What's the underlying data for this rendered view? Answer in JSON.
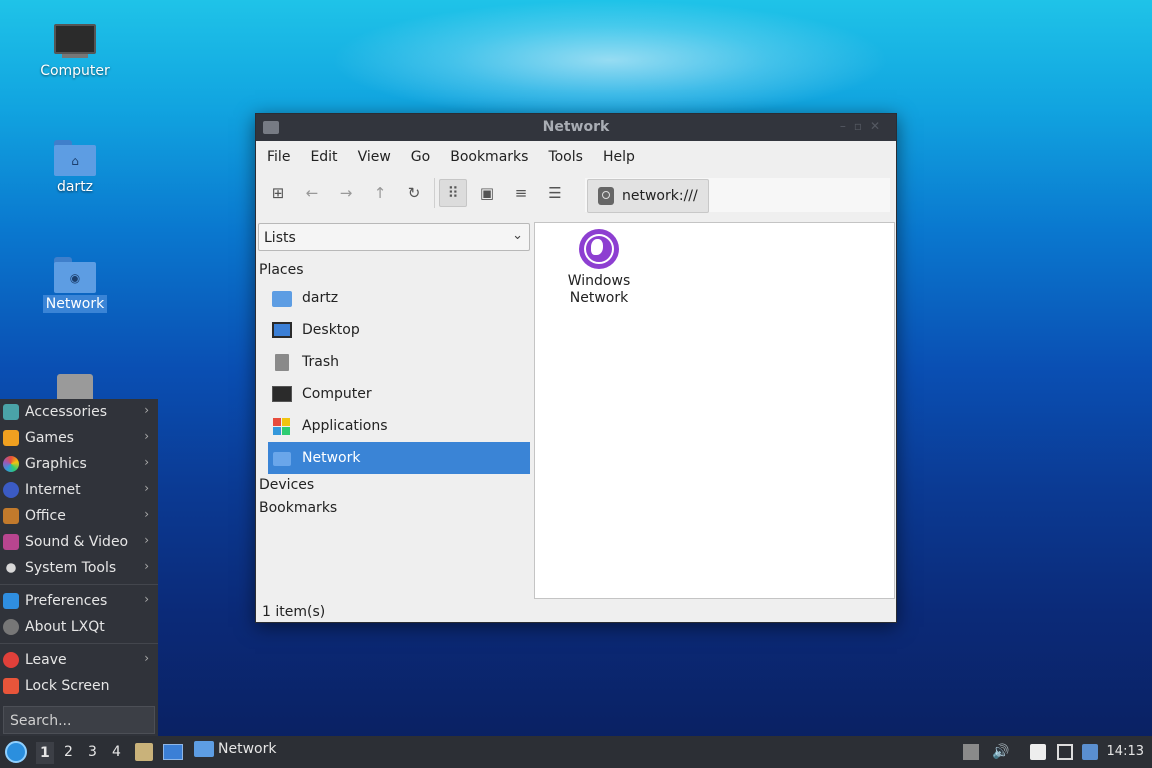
{
  "desktop": {
    "icons": [
      {
        "label": "Computer"
      },
      {
        "label": "dartz"
      },
      {
        "label": "Network"
      }
    ]
  },
  "window": {
    "title": "Network",
    "menu": [
      "File",
      "Edit",
      "Go",
      "Bookmarks",
      "Tools",
      "Help"
    ],
    "menu_view": "View",
    "path": "network:///",
    "side_combo": "Lists",
    "sections": {
      "places": "Places",
      "devices": "Devices",
      "bookmarks": "Bookmarks"
    },
    "places": [
      "dartz",
      "Desktop",
      "Trash",
      "Computer",
      "Applications",
      "Network"
    ],
    "content_item": {
      "line1": "Windows",
      "line2": "Network"
    },
    "status": "1 item(s)"
  },
  "startmenu": {
    "items": [
      "Accessories",
      "Games",
      "Graphics",
      "Internet",
      "Office",
      "Sound & Video",
      "System Tools"
    ],
    "items2": [
      "Preferences",
      "About LXQt"
    ],
    "items3": [
      "Leave",
      "Lock Screen"
    ],
    "search_placeholder": "Search..."
  },
  "taskbar": {
    "workspaces": [
      "1",
      "2",
      "3",
      "4"
    ],
    "task_label": "Network",
    "clock": "14:13"
  },
  "colors": {
    "selection": "#3a84d6",
    "titlebar": "#32353d",
    "panel": "#2c2f35",
    "network_globe": "#8d3fd1"
  }
}
